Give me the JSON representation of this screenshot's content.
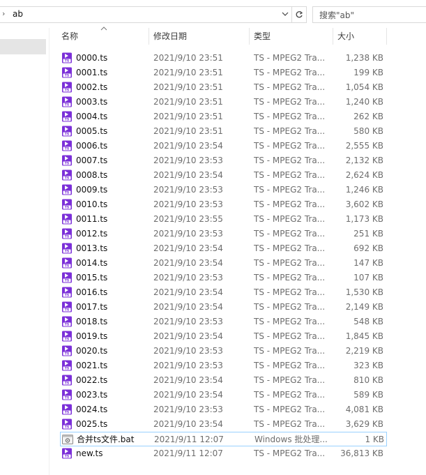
{
  "address": {
    "path": "ab"
  },
  "search": {
    "placeholder": "搜索\"ab\""
  },
  "columns": {
    "name": "名称",
    "date": "修改日期",
    "type": "类型",
    "size": "大小"
  },
  "icons": {
    "ts": "media-file-icon",
    "bat": "batch-file-icon"
  },
  "colors": {
    "ts_icon": "#7b2fd8",
    "selection_border": "#99d1ff",
    "nav_selected": "#e5e5e5"
  },
  "files": [
    {
      "name": "0000.ts",
      "date": "2021/9/10 23:51",
      "type": "TS - MPEG2 Tra...",
      "size": "1,238 KB",
      "icon": "ts"
    },
    {
      "name": "0001.ts",
      "date": "2021/9/10 23:51",
      "type": "TS - MPEG2 Tra...",
      "size": "199 KB",
      "icon": "ts"
    },
    {
      "name": "0002.ts",
      "date": "2021/9/10 23:51",
      "type": "TS - MPEG2 Tra...",
      "size": "1,054 KB",
      "icon": "ts"
    },
    {
      "name": "0003.ts",
      "date": "2021/9/10 23:51",
      "type": "TS - MPEG2 Tra...",
      "size": "1,240 KB",
      "icon": "ts"
    },
    {
      "name": "0004.ts",
      "date": "2021/9/10 23:51",
      "type": "TS - MPEG2 Tra...",
      "size": "262 KB",
      "icon": "ts"
    },
    {
      "name": "0005.ts",
      "date": "2021/9/10 23:51",
      "type": "TS - MPEG2 Tra...",
      "size": "580 KB",
      "icon": "ts"
    },
    {
      "name": "0006.ts",
      "date": "2021/9/10 23:54",
      "type": "TS - MPEG2 Tra...",
      "size": "2,555 KB",
      "icon": "ts"
    },
    {
      "name": "0007.ts",
      "date": "2021/9/10 23:53",
      "type": "TS - MPEG2 Tra...",
      "size": "2,132 KB",
      "icon": "ts"
    },
    {
      "name": "0008.ts",
      "date": "2021/9/10 23:54",
      "type": "TS - MPEG2 Tra...",
      "size": "2,624 KB",
      "icon": "ts"
    },
    {
      "name": "0009.ts",
      "date": "2021/9/10 23:53",
      "type": "TS - MPEG2 Tra...",
      "size": "1,246 KB",
      "icon": "ts"
    },
    {
      "name": "0010.ts",
      "date": "2021/9/10 23:53",
      "type": "TS - MPEG2 Tra...",
      "size": "3,602 KB",
      "icon": "ts"
    },
    {
      "name": "0011.ts",
      "date": "2021/9/10 23:55",
      "type": "TS - MPEG2 Tra...",
      "size": "1,173 KB",
      "icon": "ts"
    },
    {
      "name": "0012.ts",
      "date": "2021/9/10 23:53",
      "type": "TS - MPEG2 Tra...",
      "size": "251 KB",
      "icon": "ts"
    },
    {
      "name": "0013.ts",
      "date": "2021/9/10 23:54",
      "type": "TS - MPEG2 Tra...",
      "size": "692 KB",
      "icon": "ts"
    },
    {
      "name": "0014.ts",
      "date": "2021/9/10 23:54",
      "type": "TS - MPEG2 Tra...",
      "size": "147 KB",
      "icon": "ts"
    },
    {
      "name": "0015.ts",
      "date": "2021/9/10 23:53",
      "type": "TS - MPEG2 Tra...",
      "size": "107 KB",
      "icon": "ts"
    },
    {
      "name": "0016.ts",
      "date": "2021/9/10 23:54",
      "type": "TS - MPEG2 Tra...",
      "size": "1,530 KB",
      "icon": "ts"
    },
    {
      "name": "0017.ts",
      "date": "2021/9/10 23:54",
      "type": "TS - MPEG2 Tra...",
      "size": "2,149 KB",
      "icon": "ts"
    },
    {
      "name": "0018.ts",
      "date": "2021/9/10 23:53",
      "type": "TS - MPEG2 Tra...",
      "size": "548 KB",
      "icon": "ts"
    },
    {
      "name": "0019.ts",
      "date": "2021/9/10 23:54",
      "type": "TS - MPEG2 Tra...",
      "size": "1,845 KB",
      "icon": "ts"
    },
    {
      "name": "0020.ts",
      "date": "2021/9/10 23:53",
      "type": "TS - MPEG2 Tra...",
      "size": "2,219 KB",
      "icon": "ts"
    },
    {
      "name": "0021.ts",
      "date": "2021/9/10 23:53",
      "type": "TS - MPEG2 Tra...",
      "size": "323 KB",
      "icon": "ts"
    },
    {
      "name": "0022.ts",
      "date": "2021/9/10 23:54",
      "type": "TS - MPEG2 Tra...",
      "size": "810 KB",
      "icon": "ts"
    },
    {
      "name": "0023.ts",
      "date": "2021/9/10 23:54",
      "type": "TS - MPEG2 Tra...",
      "size": "589 KB",
      "icon": "ts"
    },
    {
      "name": "0024.ts",
      "date": "2021/9/10 23:53",
      "type": "TS - MPEG2 Tra...",
      "size": "4,081 KB",
      "icon": "ts"
    },
    {
      "name": "0025.ts",
      "date": "2021/9/10 23:54",
      "type": "TS - MPEG2 Tra...",
      "size": "3,629 KB",
      "icon": "ts"
    },
    {
      "name": "合并ts文件.bat",
      "date": "2021/9/11 12:07",
      "type": "Windows 批处理...",
      "size": "1 KB",
      "icon": "bat",
      "hover": true
    },
    {
      "name": "new.ts",
      "date": "2021/9/11 12:07",
      "type": "TS - MPEG2 Tra...",
      "size": "36,813 KB",
      "icon": "ts"
    }
  ]
}
